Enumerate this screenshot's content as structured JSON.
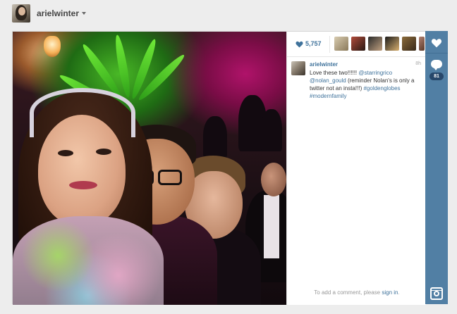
{
  "profile": {
    "username": "arielwinter"
  },
  "post": {
    "likes_count": "5,757",
    "comment_count": "81",
    "caption": {
      "username": "arielwinter",
      "time": "8h",
      "text_intro": "Love these two!!!!!! ",
      "mention_1": "@starringrico",
      "mention_2": "@nolan_gould",
      "text_middle": " (reminder Nolan's is only a twitter not an insta!!!) ",
      "hashtag_1": "#goldenglobes",
      "hashtag_2": "#modernfamily"
    },
    "signin_prompt": "To add a comment, please",
    "signin_link": "sign in",
    "signin_suffix": "."
  },
  "colors": {
    "accent": "#3f729b",
    "action_strip": "#517fa4",
    "page_bg": "#ededed"
  },
  "icons": {
    "like": "heart-icon",
    "comment": "comment-icon",
    "dropdown": "chevron-down-icon",
    "app": "camera-icon"
  }
}
